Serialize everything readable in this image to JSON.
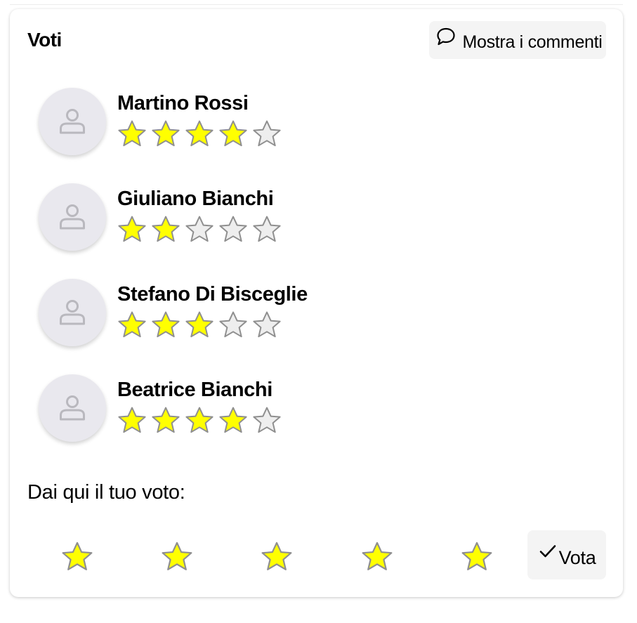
{
  "ratings_card": {
    "title": "Voti",
    "show_comments_label": "Mostra i commenti",
    "voters": [
      {
        "name": "Martino Rossi",
        "rating": 4,
        "max": 5
      },
      {
        "name": "Giuliano Bianchi",
        "rating": 2,
        "max": 5
      },
      {
        "name": "Stefano Di Bisceglie",
        "rating": 3,
        "max": 5
      },
      {
        "name": "Beatrice Bianchi",
        "rating": 4,
        "max": 5
      }
    ],
    "prompt": "Dai qui il tuo voto:",
    "rate_star_count": 5,
    "vote_label": "Vota"
  },
  "colors": {
    "star_filled": "#ffff00",
    "star_empty": "#eeeeee",
    "star_stroke": "#8f8f8f",
    "avatar_bg": "#e9e8ee",
    "avatar_icon": "#b9b8be",
    "button_bg": "#f4f4f4"
  },
  "icons": {
    "comments": "speech-bubble-icon",
    "avatar": "user-icon",
    "star": "star-icon",
    "vote": "checkmark-icon"
  }
}
